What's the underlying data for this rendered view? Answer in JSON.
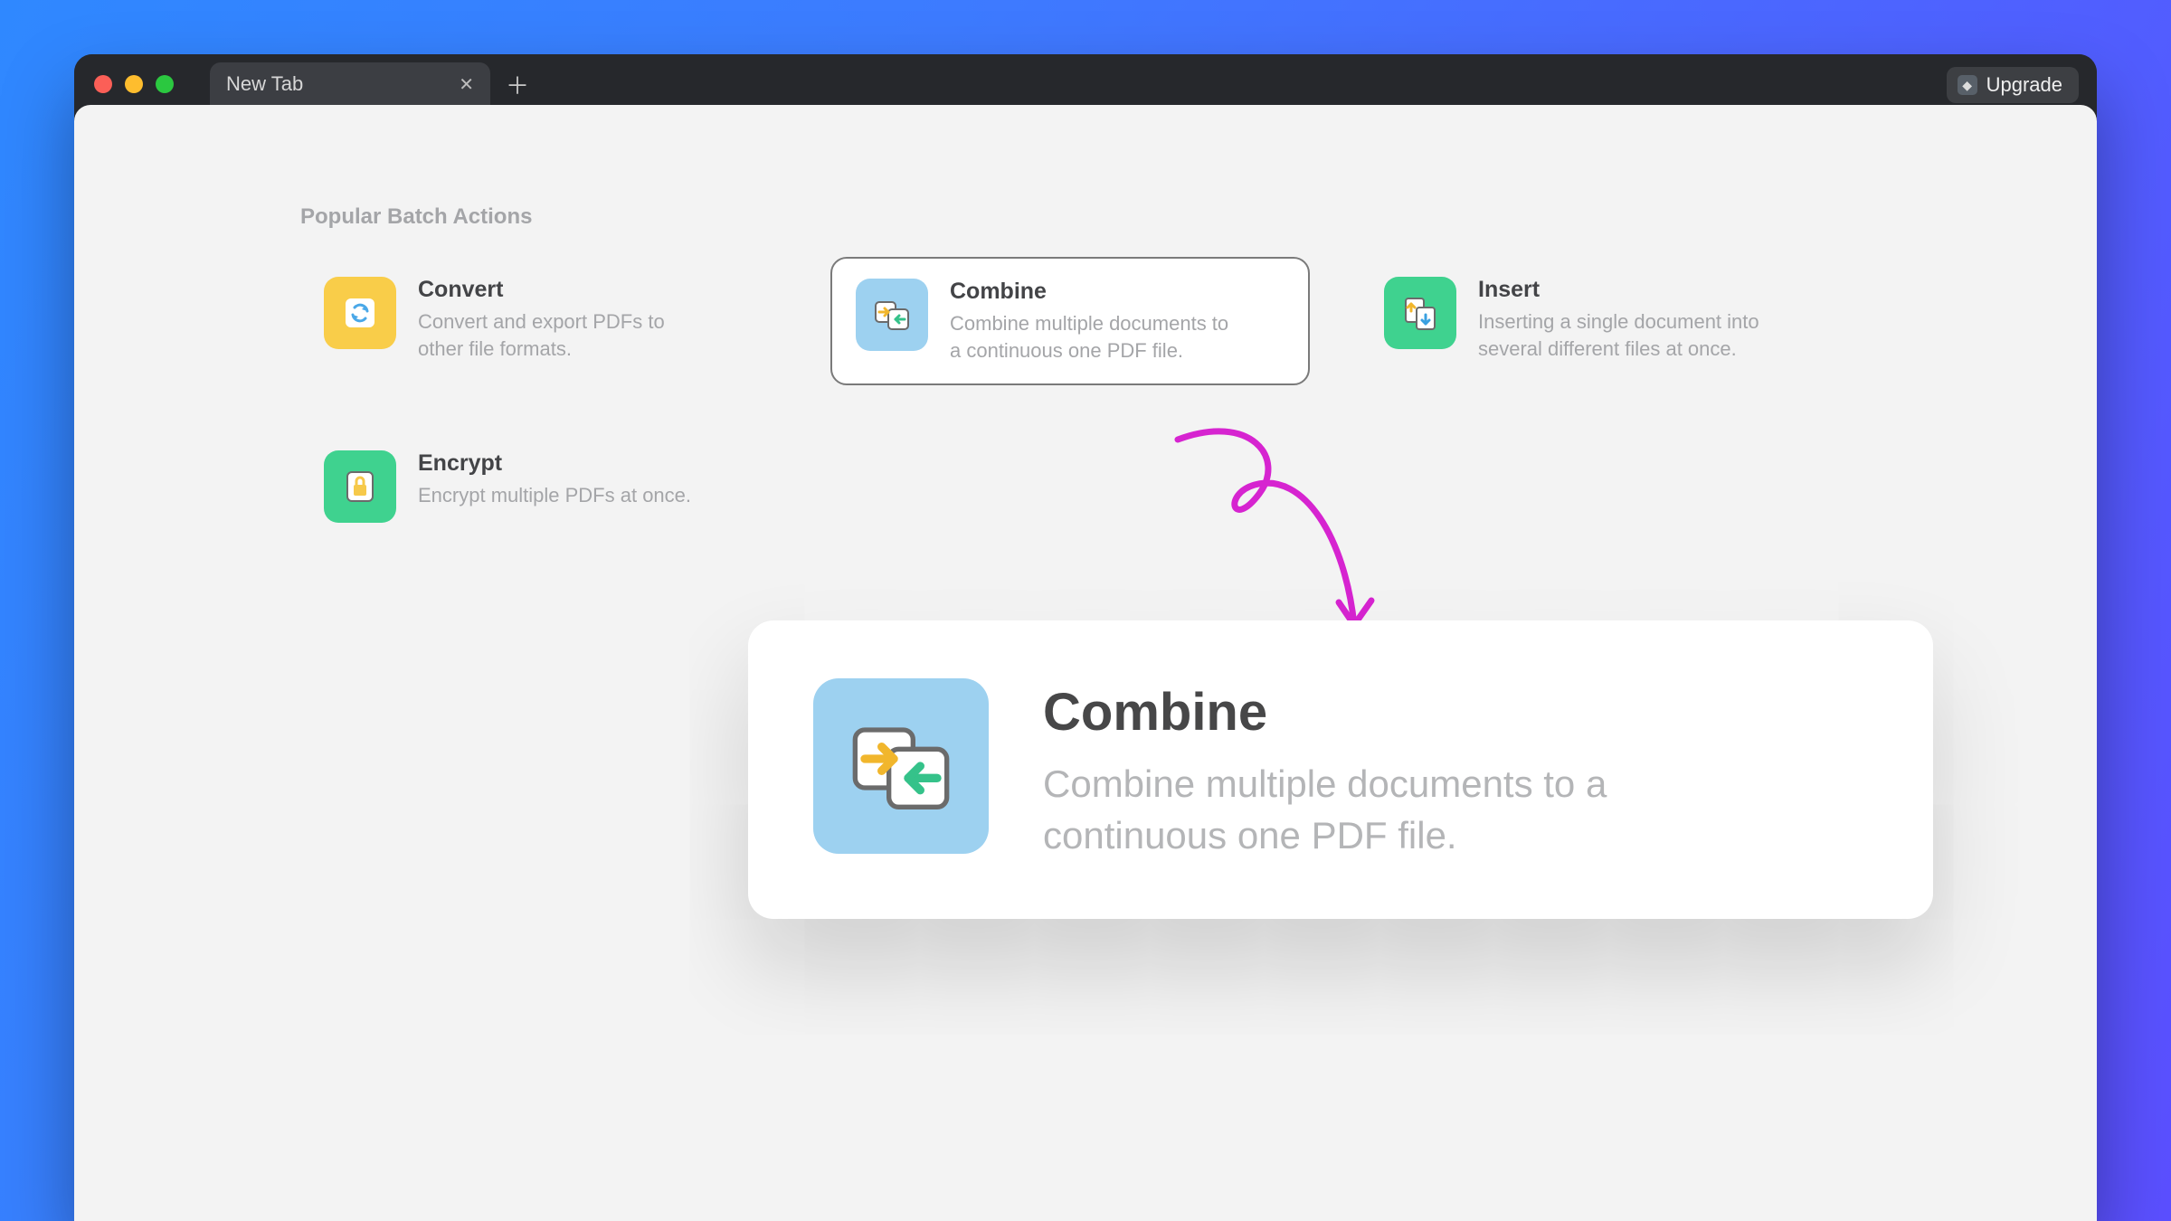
{
  "window": {
    "tab_title": "New Tab",
    "upgrade_label": "Upgrade"
  },
  "section_label": "Popular Batch Actions",
  "actions": [
    {
      "key": "convert",
      "title": "Convert",
      "desc": "Convert and export PDFs to other file formats.",
      "icon_bg": "#f9cd49",
      "selected": false
    },
    {
      "key": "combine",
      "title": "Combine",
      "desc": "Combine multiple documents to a continuous one PDF file.",
      "icon_bg": "#9dd1f0",
      "selected": true
    },
    {
      "key": "insert",
      "title": "Insert",
      "desc": "Inserting a single document into several different files at once.",
      "icon_bg": "#3fd28f",
      "selected": false
    },
    {
      "key": "encrypt",
      "title": "Encrypt",
      "desc": "Encrypt multiple PDFs at once.",
      "icon_bg": "#3fd28f",
      "selected": false
    }
  ],
  "detail": {
    "title": "Combine",
    "desc": "Combine multiple documents to a continuous one PDF file.",
    "icon_bg": "#9dd1f0"
  },
  "colors": {
    "magenta_annotation": "#d624d0"
  }
}
